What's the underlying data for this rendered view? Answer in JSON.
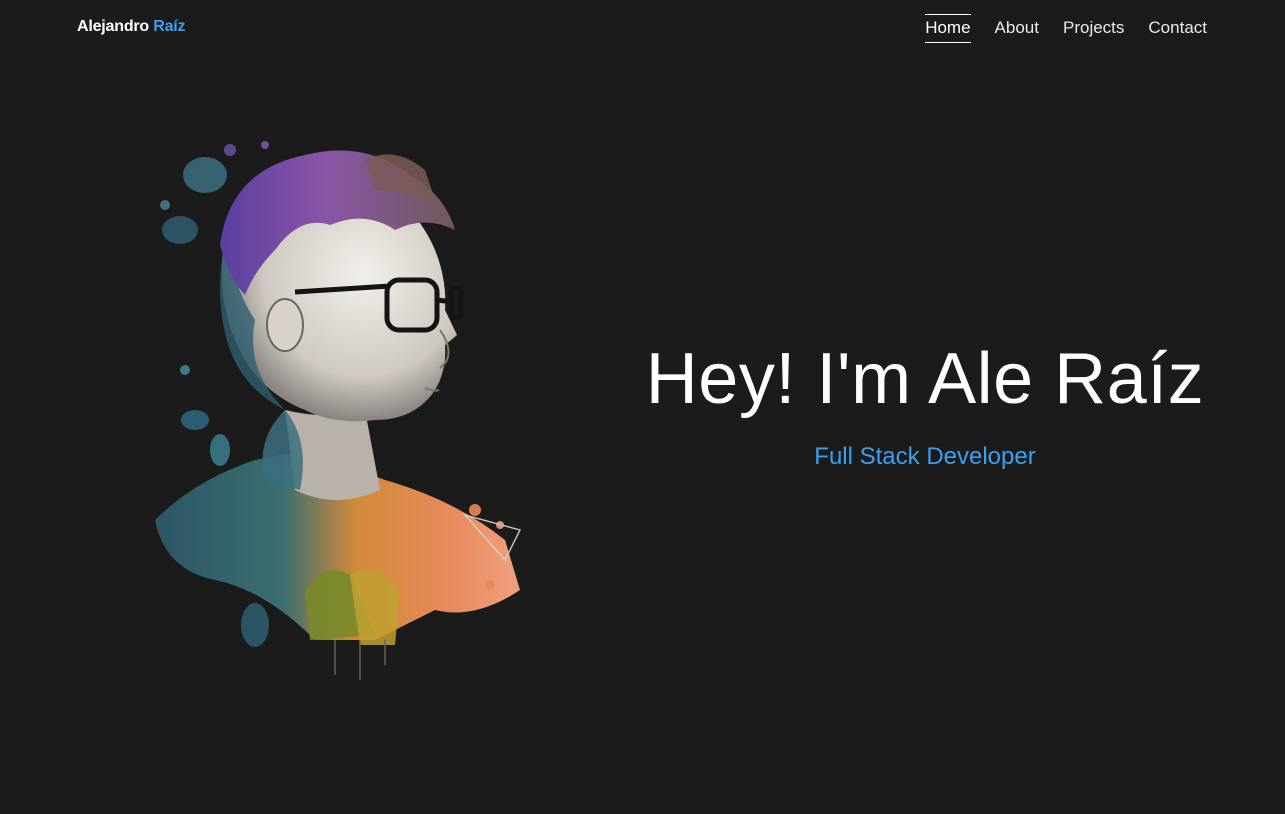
{
  "header": {
    "brand_first": "Alejandro",
    "brand_accent": "Raíz",
    "nav": [
      {
        "label": "Home",
        "active": true
      },
      {
        "label": "About",
        "active": false
      },
      {
        "label": "Projects",
        "active": false
      },
      {
        "label": "Contact",
        "active": false
      }
    ]
  },
  "hero": {
    "heading": "Hey! I'm Ale Raíz",
    "role": "Full Stack Developer",
    "portrait_icon": "watercolor-portrait"
  },
  "colors": {
    "background": "#1b1b1b",
    "accent": "#3aa0f0",
    "text": "#ffffff"
  }
}
